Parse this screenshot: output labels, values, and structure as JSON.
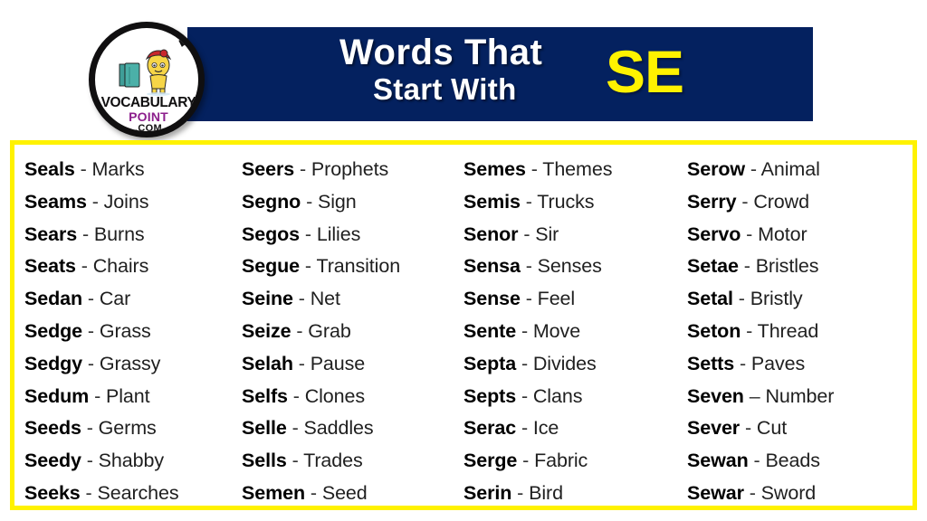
{
  "header": {
    "title_line1": "Words That",
    "title_line2": "Start With",
    "title_highlight": "SE",
    "bar_color": "#04215F",
    "highlight_color": "#FFF200",
    "title_color": "#FFFFFF"
  },
  "logo": {
    "name_top": "VOCABULARY",
    "name_mid": "POINT",
    "name_bottom": ".COM",
    "mid_color": "#8C1F8C",
    "ring_color": "#100F10",
    "character_color": "#F6D547",
    "cap_color": "#C9262C",
    "book_color": "#4BB0A8"
  },
  "panel": {
    "border_color": "#FFF200",
    "background_color": "#FFFFFF"
  },
  "columns": [
    {
      "index": 0,
      "entries": [
        {
          "term": "Seals",
          "sep": "-",
          "def": "Marks"
        },
        {
          "term": "Seams",
          "sep": "-",
          "def": "Joins"
        },
        {
          "term": "Sears",
          "sep": "-",
          "def": "Burns"
        },
        {
          "term": "Seats",
          "sep": "-",
          "def": "Chairs"
        },
        {
          "term": "Sedan",
          "sep": "-",
          "def": "Car"
        },
        {
          "term": "Sedge",
          "sep": "-",
          "def": "Grass"
        },
        {
          "term": "Sedgy",
          "sep": "-",
          "def": "Grassy"
        },
        {
          "term": "Sedum",
          "sep": "-",
          "def": "Plant"
        },
        {
          "term": "Seeds",
          "sep": "-",
          "def": "Germs"
        },
        {
          "term": "Seedy",
          "sep": "-",
          "def": "Shabby"
        },
        {
          "term": "Seeks",
          "sep": "-",
          "def": "Searches"
        }
      ]
    },
    {
      "index": 1,
      "entries": [
        {
          "term": "Seers",
          "sep": "-",
          "def": "Prophets"
        },
        {
          "term": "Segno",
          "sep": "-",
          "def": "Sign"
        },
        {
          "term": "Segos",
          "sep": "-",
          "def": "Lilies"
        },
        {
          "term": "Segue",
          "sep": "-",
          "def": "Transition"
        },
        {
          "term": "Seine",
          "sep": "-",
          "def": "Net"
        },
        {
          "term": "Seize",
          "sep": "-",
          "def": "Grab"
        },
        {
          "term": "Selah",
          "sep": "-",
          "def": "Pause"
        },
        {
          "term": "Selfs",
          "sep": "-",
          "def": "Clones"
        },
        {
          "term": "Selle",
          "sep": "-",
          "def": "Saddles"
        },
        {
          "term": "Sells",
          "sep": "-",
          "def": "Trades"
        },
        {
          "term": "Semen",
          "sep": "-",
          "def": "Seed"
        }
      ]
    },
    {
      "index": 2,
      "entries": [
        {
          "term": "Semes",
          "sep": "-",
          "def": "Themes"
        },
        {
          "term": "Semis",
          "sep": "-",
          "def": "Trucks"
        },
        {
          "term": "Senor",
          "sep": "-",
          "def": "Sir"
        },
        {
          "term": "Sensa",
          "sep": "-",
          "def": "Senses"
        },
        {
          "term": "Sense",
          "sep": "-",
          "def": "Feel"
        },
        {
          "term": "Sente",
          "sep": "-",
          "def": "Move"
        },
        {
          "term": "Septa",
          "sep": "-",
          "def": "Divides"
        },
        {
          "term": "Septs",
          "sep": "-",
          "def": "Clans"
        },
        {
          "term": "Serac",
          "sep": "-",
          "def": "Ice"
        },
        {
          "term": "Serge",
          "sep": "-",
          "def": "Fabric"
        },
        {
          "term": "Serin",
          "sep": "-",
          "def": "Bird"
        }
      ]
    },
    {
      "index": 3,
      "entries": [
        {
          "term": "Serow",
          "sep": "-",
          "def": "Animal"
        },
        {
          "term": "Serry",
          "sep": "-",
          "def": "Crowd"
        },
        {
          "term": "Servo",
          "sep": "-",
          "def": "Motor"
        },
        {
          "term": "Setae",
          "sep": "-",
          "def": "Bristles"
        },
        {
          "term": "Setal",
          "sep": "-",
          "def": "Bristly"
        },
        {
          "term": "Seton",
          "sep": "-",
          "def": "Thread"
        },
        {
          "term": "Setts",
          "sep": "-",
          "def": "Paves"
        },
        {
          "term": "Seven",
          "sep": "–",
          "def": "Number"
        },
        {
          "term": "Sever",
          "sep": "-",
          "def": "Cut"
        },
        {
          "term": "Sewan",
          "sep": "-",
          "def": "Beads"
        },
        {
          "term": "Sewar",
          "sep": "-",
          "def": "Sword"
        }
      ]
    }
  ]
}
